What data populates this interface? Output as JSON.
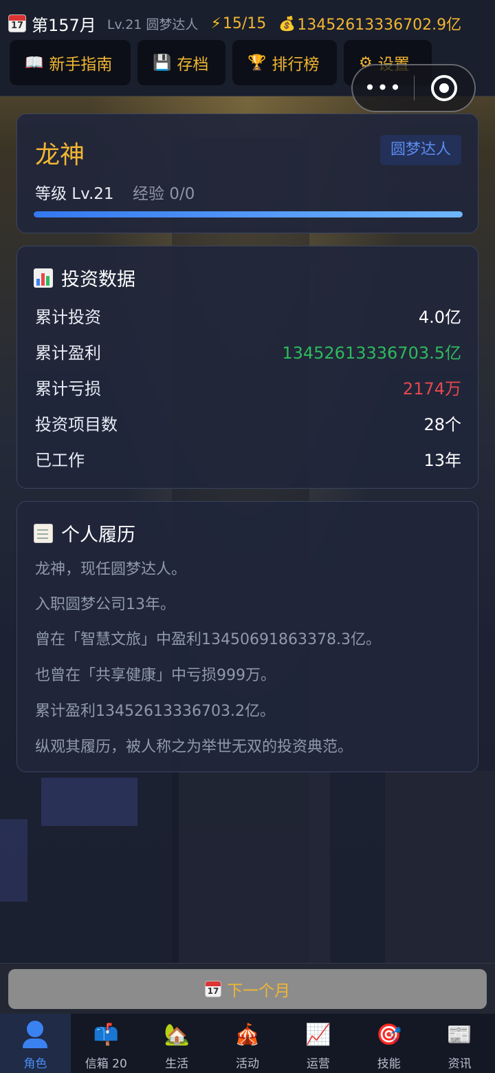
{
  "status": {
    "calendar_icon_day": "17",
    "month": "第157月",
    "level": "Lv.21 圆梦达人",
    "energy": "15/15",
    "money": "13452613336702.9亿"
  },
  "nav": {
    "guide": "新手指南",
    "save": "存档",
    "rank": "排行榜",
    "settings": "设置"
  },
  "capsule": {
    "more": "•••"
  },
  "profile": {
    "name": "龙神",
    "title": "圆梦达人",
    "level": "等级 Lv.21",
    "exp": "经验 0/0",
    "exp_progress": 1.0
  },
  "invest": {
    "title": "投资数据",
    "rows": [
      {
        "label": "累计投资",
        "value": "4.0亿"
      },
      {
        "label": "累计盈利",
        "value": "13452613336703.5亿"
      },
      {
        "label": "累计亏损",
        "value": "2174万"
      },
      {
        "label": "投资项目数",
        "value": "28个"
      },
      {
        "label": "已工作",
        "value": "13年"
      }
    ]
  },
  "resume": {
    "title": "个人履历",
    "lines": [
      "龙神，现任圆梦达人。",
      "入职圆梦公司13年。",
      "曾在「智慧文旅」中盈利13450691863378.3亿。",
      "也曾在「共享健康」中亏损999万。",
      "累计盈利13452613336703.2亿。",
      "纵观其履历，被人称之为举世无双的投资典范。"
    ]
  },
  "next_month": "下一个月",
  "tabs": [
    {
      "label": "角色",
      "icon": "person-icon"
    },
    {
      "label": "信箱 20",
      "icon": "mailbox-icon"
    },
    {
      "label": "生活",
      "icon": "house-icon"
    },
    {
      "label": "活动",
      "icon": "circus-tent-icon"
    },
    {
      "label": "运营",
      "icon": "chart-up-icon"
    },
    {
      "label": "技能",
      "icon": "target-icon"
    },
    {
      "label": "资讯",
      "icon": "newspaper-icon"
    }
  ],
  "colors": {
    "accent_gold": "#f2b632",
    "profit_green": "#2dbb5d",
    "loss_red": "#e5484d",
    "active_blue": "#4a8cf5"
  }
}
